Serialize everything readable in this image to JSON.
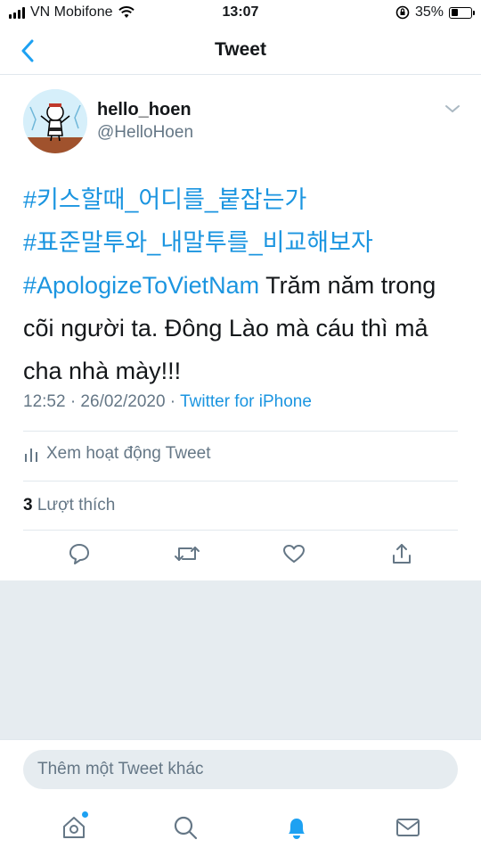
{
  "status_bar": {
    "carrier": "VN Mobifone",
    "time": "13:07",
    "battery": "35%",
    "battery_level": 0.35
  },
  "nav": {
    "title": "Tweet"
  },
  "tweet": {
    "user_name": "hello_hoen",
    "user_handle": "@HelloHoen",
    "hashtag_1": "#키스할때_어디를_붙잡는가",
    "hashtag_2": "#표준말투와_내말투를_비교해보자",
    "hashtag_3": "#ApologizeToVietNam",
    "text_line_1": " Trăm năm trong",
    "text_line_2": "cõi người ta. Đông Lào mà cáu thì mả",
    "text_line_3": "cha nhà mày!!!",
    "timestamp": "12:52 · 26/02/2020 · ",
    "source": "Twitter for iPhone",
    "activity_label": "Xem hoạt động Tweet",
    "likes_count": "3",
    "likes_label": " Lượt thích"
  },
  "reply": {
    "placeholder": "Thêm một Tweet khác"
  },
  "icons": {
    "back": "chevron-left-icon",
    "more": "chevron-down-icon",
    "activity": "bar-chart-icon",
    "reply": "comment-icon",
    "retweet": "retweet-icon",
    "like": "heart-icon",
    "share": "share-icon",
    "home": "home-icon",
    "search": "search-icon",
    "notifications": "bell-icon",
    "messages": "mail-icon"
  },
  "colors": {
    "accent": "#1da1f2",
    "link": "#1b95e0",
    "secondary_text": "#657786",
    "divider": "#e1e8ed",
    "background_grey": "#e6ecf0"
  }
}
